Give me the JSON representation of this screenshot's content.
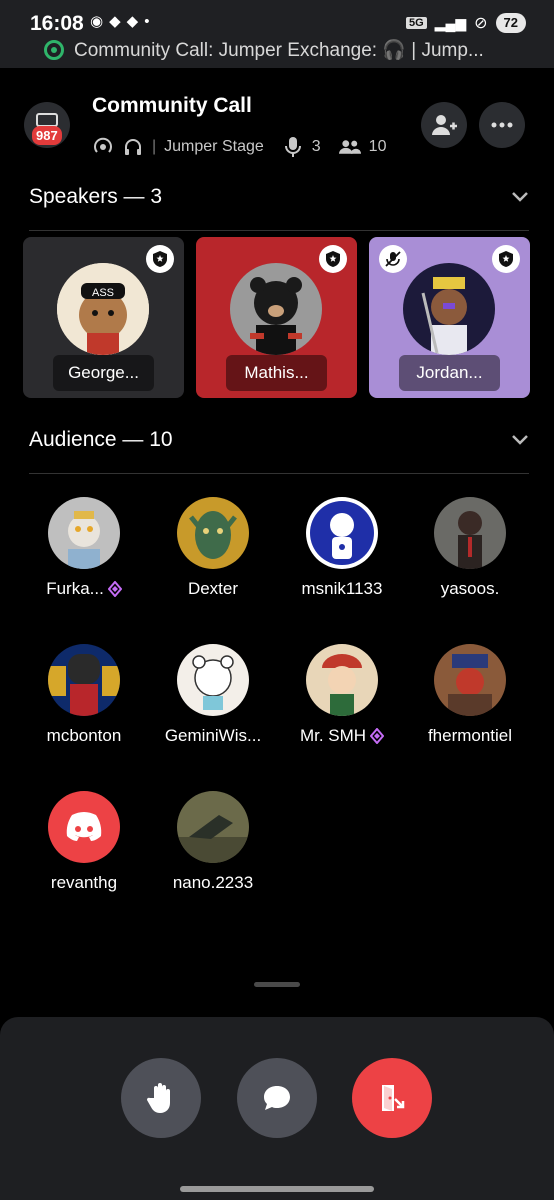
{
  "status_bar": {
    "time": "16:08",
    "battery": "72",
    "network": "5G",
    "notification": "Community Call: Jumper Exchange: 🎧 | Jump..."
  },
  "header": {
    "title": "Community Call",
    "badge": "987",
    "stage_name": "Jumper Stage",
    "speaker_count": "3",
    "listener_count": "10"
  },
  "speakers": {
    "label": "Speakers — 3",
    "items": [
      {
        "name": "George...",
        "bg": "#2b2b2e"
      },
      {
        "name": "Mathis...",
        "bg": "#b8262b"
      },
      {
        "name": "Jordan...",
        "bg": "#a98ed6"
      }
    ]
  },
  "audience": {
    "label": "Audience — 10",
    "items": [
      {
        "name": "Furka...",
        "gem": true
      },
      {
        "name": "Dexter",
        "gem": false
      },
      {
        "name": "msnik1133",
        "gem": false
      },
      {
        "name": "yasoos.",
        "gem": false
      },
      {
        "name": "mcbonton",
        "gem": false
      },
      {
        "name": "GeminiWis...",
        "gem": false
      },
      {
        "name": "Mr. SMH",
        "gem": true
      },
      {
        "name": "fhermontiel",
        "gem": false
      },
      {
        "name": "revanthg",
        "gem": false
      },
      {
        "name": "nano.2233",
        "gem": false
      }
    ]
  },
  "colors": {
    "accent_red": "#ed4245",
    "control_gray": "#4e5058",
    "gem_purple": "#c46cf5"
  }
}
